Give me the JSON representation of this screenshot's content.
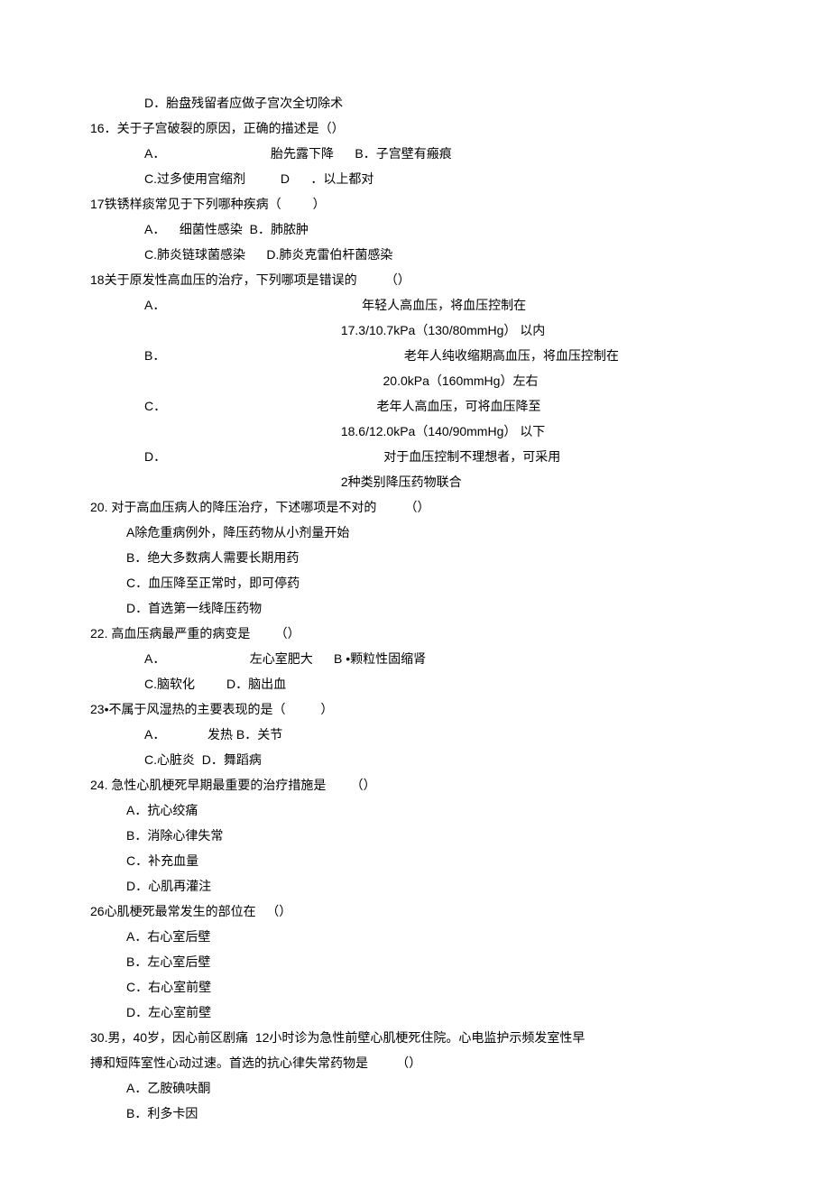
{
  "lines": [
    {
      "cls": "indent1",
      "text": "D．胎盘残留者应做子宫次全切除术"
    },
    {
      "cls": "indent0",
      "text": "16．关于子宫破裂的原因，正确的描述是（）"
    },
    {
      "cls": "indent1",
      "text": "A．                              胎先露下降      B．子宫壁有瘢痕"
    },
    {
      "cls": "indent1",
      "text": "C.过多使用宫缩剂          D      ．以上都对"
    },
    {
      "cls": "indent0",
      "text": "17铁锈样痰常见于下列哪种疾病（         ）"
    },
    {
      "cls": "indent1",
      "text": "A．    细菌性感染  B．肺脓肿"
    },
    {
      "cls": "indent1",
      "text": "C.肺炎链球菌感染      D.肺炎克雷伯杆菌感染"
    },
    {
      "cls": "indent0",
      "text": "18关于原发性高血压的治疗，下列哪项是错误的        （）"
    },
    {
      "cls": "indent1",
      "text": "A．                                                        年轻人高血压，将血压控制在"
    },
    {
      "cls": "indent1",
      "text": "                                                        17.3/10.7kPa（130/80mmHg） 以内"
    },
    {
      "cls": "indent1",
      "text": "B．                                                                    老年人纯收缩期高血压，将血压控制在"
    },
    {
      "cls": "indent1",
      "text": "                                                                    20.0kPa（160mmHg）左右"
    },
    {
      "cls": "indent1",
      "text": "C．                                                            老年人高血压，可将血压降至"
    },
    {
      "cls": "indent1",
      "text": "                                                        18.6/12.0kPa（140/90mmHg） 以下"
    },
    {
      "cls": "indent1",
      "text": "D．                                                              对于血压控制不理想者，可采用"
    },
    {
      "cls": "indent1",
      "text": "                                                        2种类别降压药物联合"
    },
    {
      "cls": "indent0",
      "text": "20. 对于高血压病人的降压治疗，下述哪项是不对的        （）"
    },
    {
      "cls": "indent2",
      "text": "A除危重病例外，降压药物从小剂量开始"
    },
    {
      "cls": "indent2",
      "text": "B．绝大多数病人需要长期用药"
    },
    {
      "cls": "indent2",
      "text": "C．血压降至正常时，即可停药"
    },
    {
      "cls": "indent2",
      "text": "D．首选第一线降压药物"
    },
    {
      "cls": "indent0",
      "text": "22. 高血压病最严重的病变是       （）"
    },
    {
      "cls": "indent1",
      "text": "A．                        左心室肥大      B •颗粒性固缩肾"
    },
    {
      "cls": "indent1",
      "text": "C.脑软化         D．脑出血"
    },
    {
      "cls": "indent0",
      "text": "23•不属于风湿热的主要表现的是（          ）"
    },
    {
      "cls": "indent1",
      "text": "A．            发热 B．关节"
    },
    {
      "cls": "indent1",
      "text": "C.心脏炎  D．舞蹈病"
    },
    {
      "cls": "indent0",
      "text": "24. 急性心肌梗死早期最重要的治疗措施是       （）"
    },
    {
      "cls": "indent2",
      "text": "A．抗心绞痛"
    },
    {
      "cls": "indent2",
      "text": "B．消除心律失常"
    },
    {
      "cls": "indent2",
      "text": "C．补充血量"
    },
    {
      "cls": "indent2",
      "text": "D．心肌再灌注"
    },
    {
      "cls": "indent0",
      "text": "26心肌梗死最常发生的部位在   （）"
    },
    {
      "cls": "indent2",
      "text": "A．右心室后壁"
    },
    {
      "cls": "indent2",
      "text": "B．左心室后壁"
    },
    {
      "cls": "indent2",
      "text": "C．右心室前壁"
    },
    {
      "cls": "indent2",
      "text": "D．左心室前壁"
    },
    {
      "cls": "indent0",
      "text": "30.男，40岁，因心前区剧痛  12小时诊为急性前壁心肌梗死住院。心电监护示频发室性早"
    },
    {
      "cls": "indent0",
      "text": "搏和短阵室性心动过速。首选的抗心律失常药物是        （）"
    },
    {
      "cls": "indent2",
      "text": "A．乙胺碘呋酮"
    },
    {
      "cls": "indent2",
      "text": "B．利多卡因"
    }
  ]
}
